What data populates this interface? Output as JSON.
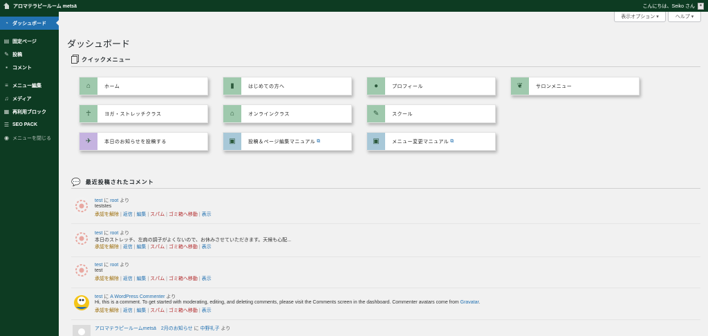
{
  "adminbar": {
    "site_name": "アロマテラピールーム metsä",
    "greeting": "こんにちは、Seiko さん"
  },
  "sidebar": {
    "items": [
      {
        "label": "ダッシュボード",
        "icon": "dashboard-icon",
        "current": true
      },
      {
        "label": "固定ページ",
        "icon": "page-icon"
      },
      {
        "label": "投稿",
        "icon": "pin-icon"
      },
      {
        "label": "コメント",
        "icon": "comment-icon"
      },
      {
        "label": "メニュー編集",
        "icon": "menu-icon"
      },
      {
        "label": "メディア",
        "icon": "media-icon"
      },
      {
        "label": "再利用ブロック",
        "icon": "block-icon"
      },
      {
        "label": "SEO PACK",
        "icon": "seo-icon"
      },
      {
        "label": "メニューを閉じる",
        "icon": "collapse-icon"
      }
    ]
  },
  "screen_options": {
    "label": "表示オプション ▾",
    "help": "ヘルプ ▾"
  },
  "page_title": "ダッシュボード",
  "quick_menu": {
    "title": "クイックメニュー",
    "tiles": [
      {
        "label": "ホーム",
        "icon": "home-icon",
        "color": "#9fc9ad"
      },
      {
        "label": "はじめての方へ",
        "icon": "book-icon",
        "color": "#9fc9ad"
      },
      {
        "label": "プロフィール",
        "icon": "person-icon",
        "color": "#9fc9ad"
      },
      {
        "label": "サロンメニュー",
        "icon": "leaf-icon",
        "color": "#9fc9ad"
      },
      {
        "label": "ヨガ・ストレッチクラス",
        "icon": "figure-icon",
        "color": "#9fc9ad"
      },
      {
        "label": "オンラインクラス",
        "icon": "home-icon",
        "color": "#9fc9ad"
      },
      {
        "label": "スクール",
        "icon": "pencil-icon",
        "color": "#9fc9ad"
      },
      {
        "label": "本日のお知らせを投稿する",
        "icon": "megaphone-icon",
        "color": "#c5b3e0"
      },
      {
        "label": "投稿＆ページ編集マニュアル",
        "icon": "manual-icon",
        "color": "#a8c8d8",
        "external": true
      },
      {
        "label": "メニュー変更マニュアル",
        "icon": "manual-icon",
        "color": "#a8c8d8",
        "external": true
      }
    ]
  },
  "recent_comments": {
    "title": "最近投稿されたコメント",
    "actions": {
      "unapprove": "承認を解除",
      "reply": "返信",
      "edit": "編集",
      "spam": "スパム",
      "trash": "ゴミ箱へ移動",
      "view": "表示"
    },
    "items": [
      {
        "author": "test",
        "sep": " に ",
        "post": "root",
        "suffix": " より",
        "text": "teststes",
        "avatar": "flower-avatar"
      },
      {
        "author": "test",
        "sep": " に ",
        "post": "root",
        "suffix": " より",
        "text": "本日のストレッチ、左肩の調子がよくないので、お休みさせていただきます。天候も心配...",
        "avatar": "flower-avatar"
      },
      {
        "author": "test",
        "sep": " に ",
        "post": "root",
        "suffix": " より",
        "text": "test",
        "avatar": "flower-avatar"
      },
      {
        "author": "test",
        "sep": " に ",
        "post": "A WordPress Commenter",
        "suffix": " より",
        "text": "Hi, this is a comment. To get started with moderating, editing, and deleting comments, please visit the Comments screen in the dashboard. Commenter avatars come from ",
        "link_text": "Gravatar",
        "text_end": ".",
        "avatar": "wapuu-avatar"
      },
      {
        "author": "アロマテラピールームmetsä　2月のお知らせ",
        "sep": " に ",
        "post": "中野礼子",
        "suffix": " より",
        "text": "",
        "avatar": "generic-avatar"
      }
    ]
  }
}
